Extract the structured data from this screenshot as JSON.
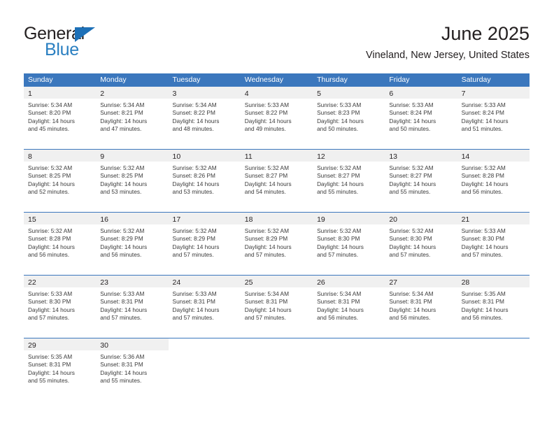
{
  "brand": {
    "name_top": "General",
    "name_bottom": "Blue",
    "triangle_color": "#1d70b7",
    "blue_text_color": "#2a7fc1"
  },
  "header": {
    "title": "June 2025",
    "subtitle": "Vineland, New Jersey, United States"
  },
  "theme": {
    "header_bg": "#3b77bd",
    "header_text": "#ffffff",
    "daynum_band_bg": "#f0f0f0",
    "row_divider": "#3b77bd",
    "body_text": "#3b3b3b"
  },
  "calendar": {
    "weekday_headers": [
      "Sunday",
      "Monday",
      "Tuesday",
      "Wednesday",
      "Thursday",
      "Friday",
      "Saturday"
    ],
    "weeks": [
      [
        {
          "day": "1",
          "sunrise": "Sunrise: 5:34 AM",
          "sunset": "Sunset: 8:20 PM",
          "daylight_1": "Daylight: 14 hours",
          "daylight_2": "and 45 minutes."
        },
        {
          "day": "2",
          "sunrise": "Sunrise: 5:34 AM",
          "sunset": "Sunset: 8:21 PM",
          "daylight_1": "Daylight: 14 hours",
          "daylight_2": "and 47 minutes."
        },
        {
          "day": "3",
          "sunrise": "Sunrise: 5:34 AM",
          "sunset": "Sunset: 8:22 PM",
          "daylight_1": "Daylight: 14 hours",
          "daylight_2": "and 48 minutes."
        },
        {
          "day": "4",
          "sunrise": "Sunrise: 5:33 AM",
          "sunset": "Sunset: 8:22 PM",
          "daylight_1": "Daylight: 14 hours",
          "daylight_2": "and 49 minutes."
        },
        {
          "day": "5",
          "sunrise": "Sunrise: 5:33 AM",
          "sunset": "Sunset: 8:23 PM",
          "daylight_1": "Daylight: 14 hours",
          "daylight_2": "and 50 minutes."
        },
        {
          "day": "6",
          "sunrise": "Sunrise: 5:33 AM",
          "sunset": "Sunset: 8:24 PM",
          "daylight_1": "Daylight: 14 hours",
          "daylight_2": "and 50 minutes."
        },
        {
          "day": "7",
          "sunrise": "Sunrise: 5:33 AM",
          "sunset": "Sunset: 8:24 PM",
          "daylight_1": "Daylight: 14 hours",
          "daylight_2": "and 51 minutes."
        }
      ],
      [
        {
          "day": "8",
          "sunrise": "Sunrise: 5:32 AM",
          "sunset": "Sunset: 8:25 PM",
          "daylight_1": "Daylight: 14 hours",
          "daylight_2": "and 52 minutes."
        },
        {
          "day": "9",
          "sunrise": "Sunrise: 5:32 AM",
          "sunset": "Sunset: 8:25 PM",
          "daylight_1": "Daylight: 14 hours",
          "daylight_2": "and 53 minutes."
        },
        {
          "day": "10",
          "sunrise": "Sunrise: 5:32 AM",
          "sunset": "Sunset: 8:26 PM",
          "daylight_1": "Daylight: 14 hours",
          "daylight_2": "and 53 minutes."
        },
        {
          "day": "11",
          "sunrise": "Sunrise: 5:32 AM",
          "sunset": "Sunset: 8:27 PM",
          "daylight_1": "Daylight: 14 hours",
          "daylight_2": "and 54 minutes."
        },
        {
          "day": "12",
          "sunrise": "Sunrise: 5:32 AM",
          "sunset": "Sunset: 8:27 PM",
          "daylight_1": "Daylight: 14 hours",
          "daylight_2": "and 55 minutes."
        },
        {
          "day": "13",
          "sunrise": "Sunrise: 5:32 AM",
          "sunset": "Sunset: 8:27 PM",
          "daylight_1": "Daylight: 14 hours",
          "daylight_2": "and 55 minutes."
        },
        {
          "day": "14",
          "sunrise": "Sunrise: 5:32 AM",
          "sunset": "Sunset: 8:28 PM",
          "daylight_1": "Daylight: 14 hours",
          "daylight_2": "and 56 minutes."
        }
      ],
      [
        {
          "day": "15",
          "sunrise": "Sunrise: 5:32 AM",
          "sunset": "Sunset: 8:28 PM",
          "daylight_1": "Daylight: 14 hours",
          "daylight_2": "and 56 minutes."
        },
        {
          "day": "16",
          "sunrise": "Sunrise: 5:32 AM",
          "sunset": "Sunset: 8:29 PM",
          "daylight_1": "Daylight: 14 hours",
          "daylight_2": "and 56 minutes."
        },
        {
          "day": "17",
          "sunrise": "Sunrise: 5:32 AM",
          "sunset": "Sunset: 8:29 PM",
          "daylight_1": "Daylight: 14 hours",
          "daylight_2": "and 57 minutes."
        },
        {
          "day": "18",
          "sunrise": "Sunrise: 5:32 AM",
          "sunset": "Sunset: 8:29 PM",
          "daylight_1": "Daylight: 14 hours",
          "daylight_2": "and 57 minutes."
        },
        {
          "day": "19",
          "sunrise": "Sunrise: 5:32 AM",
          "sunset": "Sunset: 8:30 PM",
          "daylight_1": "Daylight: 14 hours",
          "daylight_2": "and 57 minutes."
        },
        {
          "day": "20",
          "sunrise": "Sunrise: 5:32 AM",
          "sunset": "Sunset: 8:30 PM",
          "daylight_1": "Daylight: 14 hours",
          "daylight_2": "and 57 minutes."
        },
        {
          "day": "21",
          "sunrise": "Sunrise: 5:33 AM",
          "sunset": "Sunset: 8:30 PM",
          "daylight_1": "Daylight: 14 hours",
          "daylight_2": "and 57 minutes."
        }
      ],
      [
        {
          "day": "22",
          "sunrise": "Sunrise: 5:33 AM",
          "sunset": "Sunset: 8:30 PM",
          "daylight_1": "Daylight: 14 hours",
          "daylight_2": "and 57 minutes."
        },
        {
          "day": "23",
          "sunrise": "Sunrise: 5:33 AM",
          "sunset": "Sunset: 8:31 PM",
          "daylight_1": "Daylight: 14 hours",
          "daylight_2": "and 57 minutes."
        },
        {
          "day": "24",
          "sunrise": "Sunrise: 5:33 AM",
          "sunset": "Sunset: 8:31 PM",
          "daylight_1": "Daylight: 14 hours",
          "daylight_2": "and 57 minutes."
        },
        {
          "day": "25",
          "sunrise": "Sunrise: 5:34 AM",
          "sunset": "Sunset: 8:31 PM",
          "daylight_1": "Daylight: 14 hours",
          "daylight_2": "and 57 minutes."
        },
        {
          "day": "26",
          "sunrise": "Sunrise: 5:34 AM",
          "sunset": "Sunset: 8:31 PM",
          "daylight_1": "Daylight: 14 hours",
          "daylight_2": "and 56 minutes."
        },
        {
          "day": "27",
          "sunrise": "Sunrise: 5:34 AM",
          "sunset": "Sunset: 8:31 PM",
          "daylight_1": "Daylight: 14 hours",
          "daylight_2": "and 56 minutes."
        },
        {
          "day": "28",
          "sunrise": "Sunrise: 5:35 AM",
          "sunset": "Sunset: 8:31 PM",
          "daylight_1": "Daylight: 14 hours",
          "daylight_2": "and 56 minutes."
        }
      ],
      [
        {
          "day": "29",
          "sunrise": "Sunrise: 5:35 AM",
          "sunset": "Sunset: 8:31 PM",
          "daylight_1": "Daylight: 14 hours",
          "daylight_2": "and 55 minutes."
        },
        {
          "day": "30",
          "sunrise": "Sunrise: 5:36 AM",
          "sunset": "Sunset: 8:31 PM",
          "daylight_1": "Daylight: 14 hours",
          "daylight_2": "and 55 minutes."
        },
        {
          "day": "",
          "sunrise": "",
          "sunset": "",
          "daylight_1": "",
          "daylight_2": ""
        },
        {
          "day": "",
          "sunrise": "",
          "sunset": "",
          "daylight_1": "",
          "daylight_2": ""
        },
        {
          "day": "",
          "sunrise": "",
          "sunset": "",
          "daylight_1": "",
          "daylight_2": ""
        },
        {
          "day": "",
          "sunrise": "",
          "sunset": "",
          "daylight_1": "",
          "daylight_2": ""
        },
        {
          "day": "",
          "sunrise": "",
          "sunset": "",
          "daylight_1": "",
          "daylight_2": ""
        }
      ]
    ]
  }
}
